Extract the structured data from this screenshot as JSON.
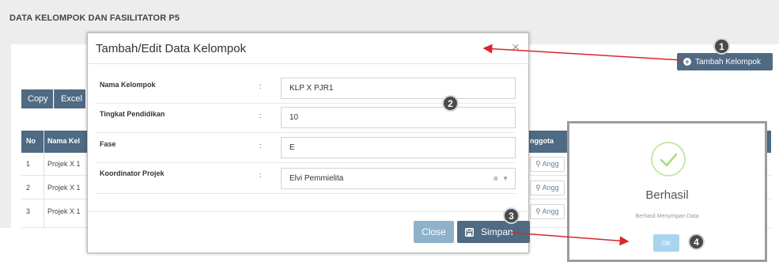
{
  "page": {
    "title": "DATA KELOMPOK DAN FASILITATOR P5"
  },
  "toolbar": {
    "add_label": "Tambah Kelompok",
    "copy_label": "Copy",
    "excel_label": "Excel"
  },
  "table": {
    "headers": {
      "no": "No",
      "name": "Nama Kel",
      "members": "nggota"
    },
    "rows": [
      {
        "no": "1",
        "name": "Projek X 1",
        "action": "Angg"
      },
      {
        "no": "2",
        "name": "Projek X 1",
        "action": "Angg"
      },
      {
        "no": "3",
        "name": "Projek X 1",
        "action": "Angg"
      }
    ]
  },
  "modal": {
    "title": "Tambah/Edit Data Kelompok",
    "close_icon": "×",
    "colon": ":",
    "fields": [
      {
        "label": "Nama Kelompok",
        "value": "KLP X PJR1"
      },
      {
        "label": "Tingkat Pendidikan",
        "value": "10"
      },
      {
        "label": "Fase",
        "value": "E"
      },
      {
        "label": "Koordinator Projek",
        "value": "Elvi Pemmielita"
      }
    ],
    "close_label": "Close",
    "save_label": "Simpan"
  },
  "alert": {
    "title": "Berhasil",
    "message": "Berhasil Menyimpan Data",
    "ok_label": "OK"
  },
  "steps": [
    "1",
    "2",
    "3",
    "4"
  ],
  "colors": {
    "primary": "#4f6a83",
    "annotation_arrow": "#d9262b",
    "success": "#a8dc78",
    "ok_button": "#a9d4ee"
  },
  "icons": [
    "plus-circle-icon",
    "close-icon",
    "save-icon",
    "user-edit-icon",
    "check-icon",
    "clear-icon",
    "caret-down-icon"
  ]
}
